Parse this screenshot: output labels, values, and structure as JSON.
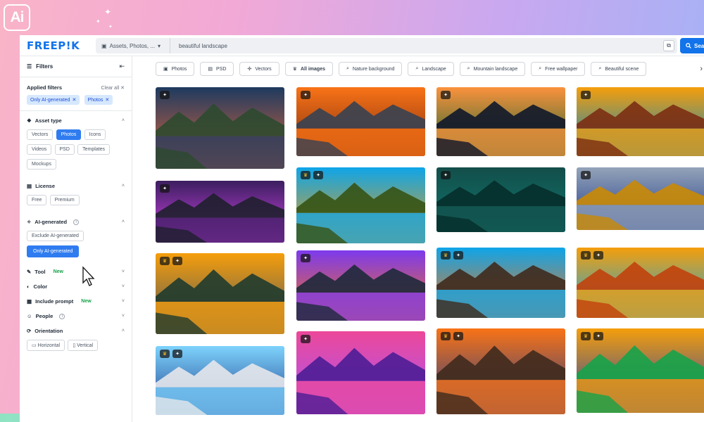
{
  "brand": {
    "logo_text": "FREEP!K",
    "badge_text": "Ai"
  },
  "search": {
    "asset_type": "Assets, Photos, ...",
    "query": "beautiful landscape",
    "button_label": "Sea"
  },
  "filters": {
    "title": "Filters",
    "applied_label": "Applied filters",
    "clear_all": "Clear all",
    "applied": [
      "Only AI-generated",
      "Photos"
    ],
    "asset_type": {
      "label": "Asset type",
      "options": [
        "Vectors",
        "Photos",
        "Icons",
        "Videos",
        "PSD",
        "Templates",
        "Mockups"
      ],
      "selected": "Photos"
    },
    "license": {
      "label": "License",
      "options": [
        "Free",
        "Premium"
      ]
    },
    "ai_generated": {
      "label": "AI-generated",
      "options": [
        "Exclude AI-generated",
        "Only AI-generated"
      ],
      "selected": "Only AI-generated"
    },
    "tool": {
      "label": "Tool",
      "badge": "New"
    },
    "color": {
      "label": "Color"
    },
    "include_prompt": {
      "label": "Include prompt",
      "badge": "New"
    },
    "people": {
      "label": "People"
    },
    "orientation": {
      "label": "Orientation",
      "options": [
        "Horizontal",
        "Vertical"
      ]
    }
  },
  "tags": [
    {
      "label": "Photos",
      "icon": "image-icon"
    },
    {
      "label": "PSD",
      "icon": "psd-icon"
    },
    {
      "label": "Vectors",
      "icon": "vector-icon"
    },
    {
      "label": "All images",
      "icon": "crown-icon",
      "bold": true
    },
    {
      "label": "Nature background",
      "icon": "search-icon"
    },
    {
      "label": "Landscape",
      "icon": "search-icon"
    },
    {
      "label": "Mountain landscape",
      "icon": "search-icon"
    },
    {
      "label": "Free wallpaper",
      "icon": "search-icon"
    },
    {
      "label": "Beautiful scene",
      "icon": "search-icon"
    }
  ],
  "colors": {
    "accent": "#1273eb",
    "selected_pill": "#2f7cf0",
    "new_badge": "#16a34a"
  }
}
